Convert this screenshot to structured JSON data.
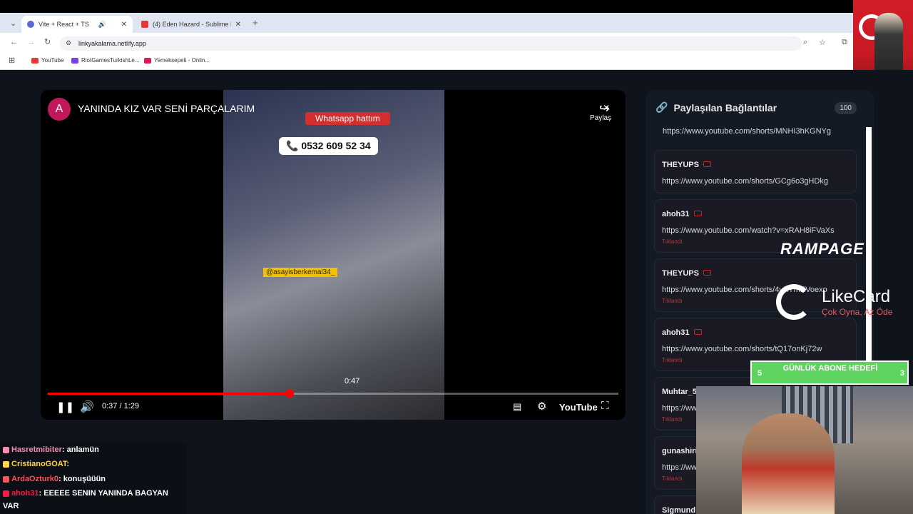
{
  "browser": {
    "tabs": [
      {
        "title": "Vite + React + TS",
        "active": true
      },
      {
        "title": "(4) Eden Hazard - Sublime Dribbl",
        "active": false
      }
    ],
    "url": "linkyakalama.netlify.app",
    "bookmarks": [
      "YouTube",
      "RiotGamesTurkishLe...",
      "Yemeksepeti - Onlin..."
    ]
  },
  "player": {
    "channel_initial": "A",
    "title": "YANINDA KIZ VAR SENİ PARÇALARIM",
    "share_label": "Paylaş",
    "overlay_whatsapp": "Whatsapp hattım",
    "overlay_phone": "0532 609 52 34",
    "overlay_tag": "@asayisberkemal34_",
    "hover_time": "0:47",
    "time_display": "0:37 / 1:29",
    "progress_fraction": 0.424,
    "youtube_label": "YouTube"
  },
  "links_panel": {
    "title": "Paylaşılan Bağlantılar",
    "count": "100",
    "clicked_label": "Tıklandı",
    "top_link": "https://www.youtube.com/shorts/MNHI3hKGNYg",
    "items": [
      {
        "user": "THEYUPS",
        "link": "https://www.youtube.com/shorts/GCg6o3gHDkg",
        "clicked": false
      },
      {
        "user": "ahoh31",
        "link": "https://www.youtube.com/watch?v=xRAH8iFVaXs",
        "clicked": true
      },
      {
        "user": "THEYUPS",
        "link": "https://www.youtube.com/shorts/4vXYmEVoexo",
        "clicked": true
      },
      {
        "user": "ahoh31",
        "link": "https://www.youtube.com/shorts/tQ17onKj72w",
        "clicked": true
      },
      {
        "user": "Muhtar_58",
        "link": "https://ww",
        "clicked": true
      },
      {
        "user": "gunashiri",
        "link": "https://ww",
        "clicked": true
      },
      {
        "user": "Sigmund",
        "link": "",
        "clicked": false
      }
    ]
  },
  "stream_overlay": {
    "brand1": "RAMPAGE",
    "brand2": "LikeCard",
    "brand2_slogan": "Çok Oyna, Az Öde",
    "sub_goal_title": "GÜNLÜK ABONE HEDEFİ",
    "sub_goal_current": "5",
    "sub_goal_target": "3"
  },
  "chat": [
    {
      "user": "Hasretmibiter",
      "text": ": anlamün",
      "color": "#f48fb1"
    },
    {
      "user": "CristianoGOAT",
      "text": ":",
      "color": "#ffd54f"
    },
    {
      "user": "ArdaOzturk0",
      "text": ": konuşüüün",
      "color": "#ff5252"
    },
    {
      "user": "ahoh31",
      "text": ": EEEEE SENIN YANINDA BAGYAN",
      "color": "#ff1744"
    },
    {
      "user": "",
      "text": "VAR",
      "color": "#ffffff"
    }
  ]
}
